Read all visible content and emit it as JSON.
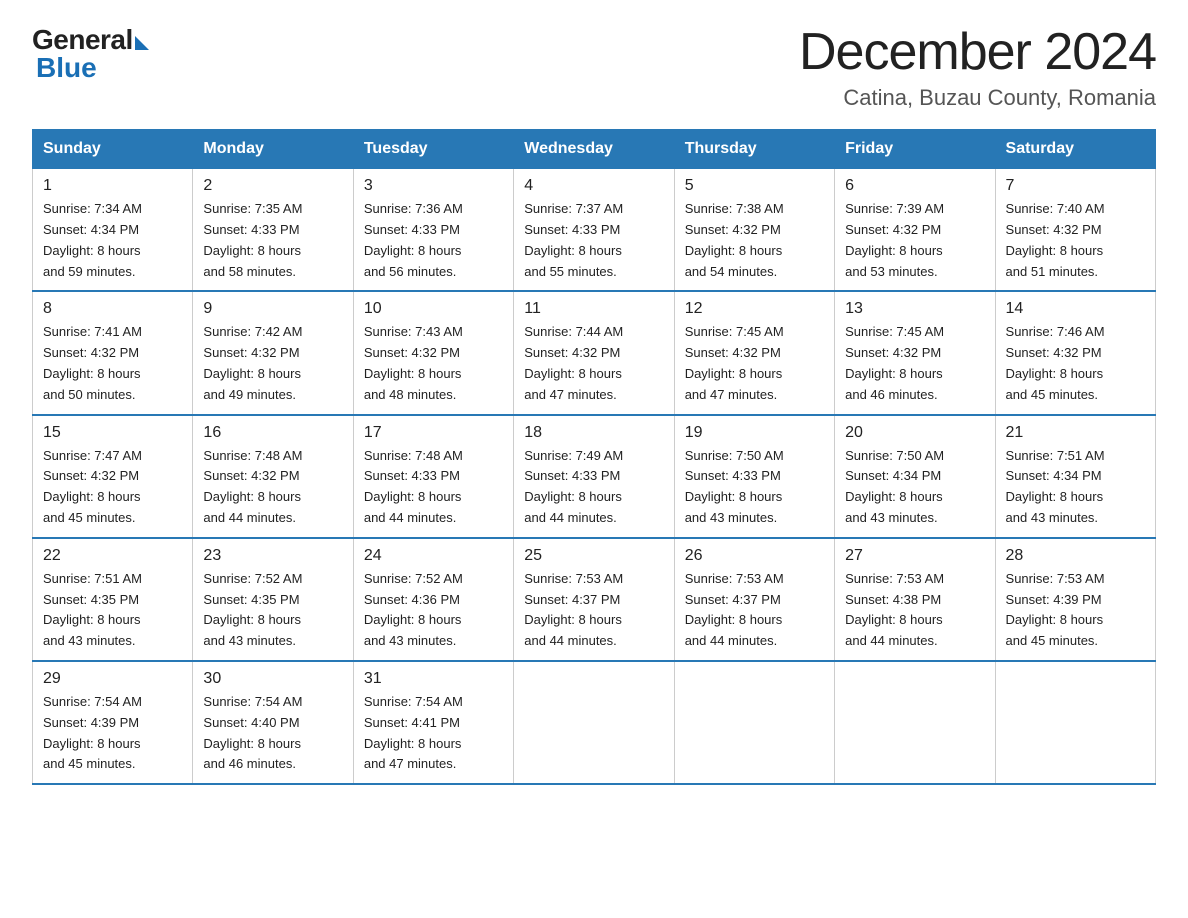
{
  "logo": {
    "general": "General",
    "blue": "Blue"
  },
  "title": "December 2024",
  "location": "Catina, Buzau County, Romania",
  "headers": [
    "Sunday",
    "Monday",
    "Tuesday",
    "Wednesday",
    "Thursday",
    "Friday",
    "Saturday"
  ],
  "weeks": [
    [
      {
        "day": "1",
        "sunrise": "7:34 AM",
        "sunset": "4:34 PM",
        "daylight": "8 hours and 59 minutes."
      },
      {
        "day": "2",
        "sunrise": "7:35 AM",
        "sunset": "4:33 PM",
        "daylight": "8 hours and 58 minutes."
      },
      {
        "day": "3",
        "sunrise": "7:36 AM",
        "sunset": "4:33 PM",
        "daylight": "8 hours and 56 minutes."
      },
      {
        "day": "4",
        "sunrise": "7:37 AM",
        "sunset": "4:33 PM",
        "daylight": "8 hours and 55 minutes."
      },
      {
        "day": "5",
        "sunrise": "7:38 AM",
        "sunset": "4:32 PM",
        "daylight": "8 hours and 54 minutes."
      },
      {
        "day": "6",
        "sunrise": "7:39 AM",
        "sunset": "4:32 PM",
        "daylight": "8 hours and 53 minutes."
      },
      {
        "day": "7",
        "sunrise": "7:40 AM",
        "sunset": "4:32 PM",
        "daylight": "8 hours and 51 minutes."
      }
    ],
    [
      {
        "day": "8",
        "sunrise": "7:41 AM",
        "sunset": "4:32 PM",
        "daylight": "8 hours and 50 minutes."
      },
      {
        "day": "9",
        "sunrise": "7:42 AM",
        "sunset": "4:32 PM",
        "daylight": "8 hours and 49 minutes."
      },
      {
        "day": "10",
        "sunrise": "7:43 AM",
        "sunset": "4:32 PM",
        "daylight": "8 hours and 48 minutes."
      },
      {
        "day": "11",
        "sunrise": "7:44 AM",
        "sunset": "4:32 PM",
        "daylight": "8 hours and 47 minutes."
      },
      {
        "day": "12",
        "sunrise": "7:45 AM",
        "sunset": "4:32 PM",
        "daylight": "8 hours and 47 minutes."
      },
      {
        "day": "13",
        "sunrise": "7:45 AM",
        "sunset": "4:32 PM",
        "daylight": "8 hours and 46 minutes."
      },
      {
        "day": "14",
        "sunrise": "7:46 AM",
        "sunset": "4:32 PM",
        "daylight": "8 hours and 45 minutes."
      }
    ],
    [
      {
        "day": "15",
        "sunrise": "7:47 AM",
        "sunset": "4:32 PM",
        "daylight": "8 hours and 45 minutes."
      },
      {
        "day": "16",
        "sunrise": "7:48 AM",
        "sunset": "4:32 PM",
        "daylight": "8 hours and 44 minutes."
      },
      {
        "day": "17",
        "sunrise": "7:48 AM",
        "sunset": "4:33 PM",
        "daylight": "8 hours and 44 minutes."
      },
      {
        "day": "18",
        "sunrise": "7:49 AM",
        "sunset": "4:33 PM",
        "daylight": "8 hours and 44 minutes."
      },
      {
        "day": "19",
        "sunrise": "7:50 AM",
        "sunset": "4:33 PM",
        "daylight": "8 hours and 43 minutes."
      },
      {
        "day": "20",
        "sunrise": "7:50 AM",
        "sunset": "4:34 PM",
        "daylight": "8 hours and 43 minutes."
      },
      {
        "day": "21",
        "sunrise": "7:51 AM",
        "sunset": "4:34 PM",
        "daylight": "8 hours and 43 minutes."
      }
    ],
    [
      {
        "day": "22",
        "sunrise": "7:51 AM",
        "sunset": "4:35 PM",
        "daylight": "8 hours and 43 minutes."
      },
      {
        "day": "23",
        "sunrise": "7:52 AM",
        "sunset": "4:35 PM",
        "daylight": "8 hours and 43 minutes."
      },
      {
        "day": "24",
        "sunrise": "7:52 AM",
        "sunset": "4:36 PM",
        "daylight": "8 hours and 43 minutes."
      },
      {
        "day": "25",
        "sunrise": "7:53 AM",
        "sunset": "4:37 PM",
        "daylight": "8 hours and 44 minutes."
      },
      {
        "day": "26",
        "sunrise": "7:53 AM",
        "sunset": "4:37 PM",
        "daylight": "8 hours and 44 minutes."
      },
      {
        "day": "27",
        "sunrise": "7:53 AM",
        "sunset": "4:38 PM",
        "daylight": "8 hours and 44 minutes."
      },
      {
        "day": "28",
        "sunrise": "7:53 AM",
        "sunset": "4:39 PM",
        "daylight": "8 hours and 45 minutes."
      }
    ],
    [
      {
        "day": "29",
        "sunrise": "7:54 AM",
        "sunset": "4:39 PM",
        "daylight": "8 hours and 45 minutes."
      },
      {
        "day": "30",
        "sunrise": "7:54 AM",
        "sunset": "4:40 PM",
        "daylight": "8 hours and 46 minutes."
      },
      {
        "day": "31",
        "sunrise": "7:54 AM",
        "sunset": "4:41 PM",
        "daylight": "8 hours and 47 minutes."
      },
      null,
      null,
      null,
      null
    ]
  ],
  "labels": {
    "sunrise": "Sunrise:",
    "sunset": "Sunset:",
    "daylight": "Daylight:"
  }
}
